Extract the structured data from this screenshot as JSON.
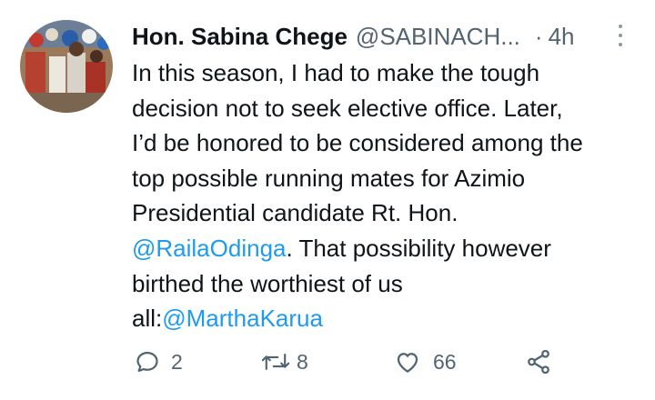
{
  "tweet": {
    "author_name": "Hon. Sabina Chege",
    "author_handle": "@SABINACH...",
    "separator": "·",
    "timestamp": "4h",
    "text_lines": [
      "In this season, I had to make the tough",
      "decision not to seek elective office. Later,",
      "I’d be honored to be considered among the",
      "top possible running mates for Azimio",
      "Presidential candidate Rt. Hon."
    ],
    "line6": {
      "mention": "@RailaOdinga",
      "text": ". That possibility however"
    },
    "line7": "birthed the worthiest of us",
    "line8": {
      "prefix": "all:",
      "mention": "@MarthaKarua"
    }
  },
  "actions": {
    "reply_count": "2",
    "retweet_count": "8",
    "like_count": "66"
  },
  "colors": {
    "text": "#0f1419",
    "secondary": "#536471",
    "link": "#1d9bf0",
    "background": "#ffffff"
  },
  "icons": [
    "more-icon",
    "reply-icon",
    "retweet-icon",
    "like-icon",
    "share-icon"
  ]
}
